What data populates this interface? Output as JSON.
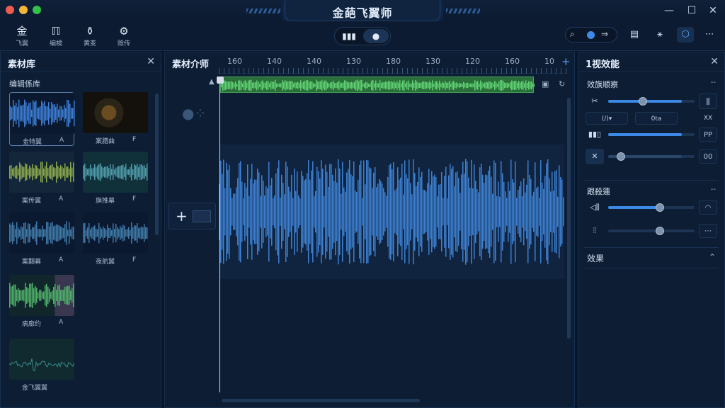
{
  "app": {
    "title": "金葩飞翼师"
  },
  "toolbar": {
    "tools": [
      {
        "label": "飞翼",
        "icon": "gold-glyph-icon"
      },
      {
        "label": "编検",
        "icon": "edit-icon"
      },
      {
        "label": "黄变",
        "icon": "mask-icon"
      },
      {
        "label": "赊传",
        "icon": "gear-icon"
      }
    ],
    "view_modes": [
      "bar-chart-icon",
      "droplet-icon"
    ]
  },
  "library": {
    "title": "素材库",
    "subtitle": "编辑係库",
    "clips": [
      {
        "name": "金特翼",
        "tag": "A"
      },
      {
        "name": "案腊曲",
        "tag": "F"
      },
      {
        "name": "案传翼",
        "tag": "A"
      },
      {
        "name": "旗推幕",
        "tag": "F"
      },
      {
        "name": "案翻幕",
        "tag": "A"
      },
      {
        "name": "夜航翼",
        "tag": "F"
      },
      {
        "name": "病廊约",
        "tag": "A"
      },
      {
        "name": "金飞翼翼",
        "tag": ""
      }
    ]
  },
  "timeline": {
    "title": "素材介师",
    "ruler": [
      "160",
      "140",
      "140",
      "130",
      "180",
      "130",
      "120",
      "160",
      "10"
    ],
    "add_label": "+"
  },
  "effects": {
    "title": "1视效能",
    "section1": "效旗顺察",
    "section1_dash": "--",
    "section2": "跟殺蓮",
    "section2_dash": "--",
    "section3": "效果",
    "chips": [
      "(/)▾",
      "0ta",
      "XX"
    ],
    "vals": [
      "PP",
      "00"
    ],
    "sliders": [
      {
        "fill": 0.85,
        "knob": 0.4
      },
      {
        "fill": 0.85,
        "knob": 0.0
      },
      {
        "fill": 0.85,
        "knob": 0.15
      },
      {
        "fill": 0.6,
        "knob": 0.6
      },
      {
        "fill": 0.0,
        "knob": 0.6
      }
    ]
  }
}
